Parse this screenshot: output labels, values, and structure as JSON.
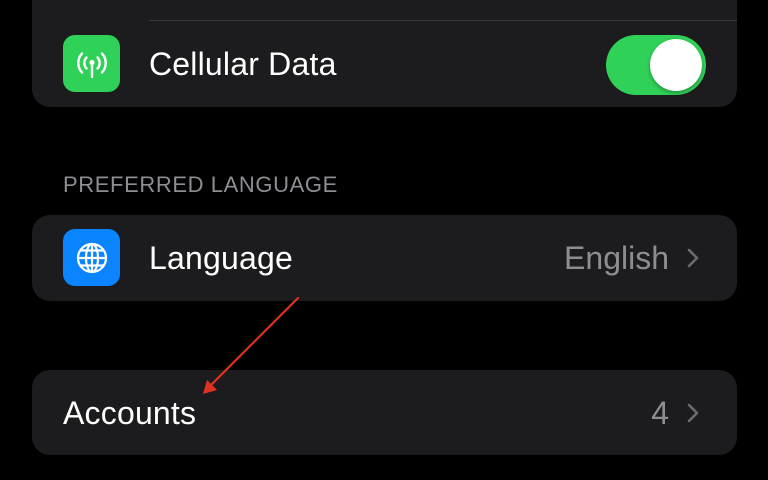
{
  "colors": {
    "background": "#000000",
    "group_bg": "#1c1c1e",
    "cellular_icon_bg": "#30d158",
    "language_icon_bg": "#0a84ff",
    "toggle_on": "#30d158",
    "secondary_text": "#8d8d93",
    "annotation_arrow": "#e0311f"
  },
  "cellular": {
    "icon": "antenna-signal-icon",
    "label": "Cellular Data",
    "toggle_state": "on"
  },
  "preferred_language": {
    "header": "PREFERRED LANGUAGE",
    "row": {
      "icon": "globe-icon",
      "label": "Language",
      "value": "English"
    }
  },
  "accounts": {
    "label": "Accounts",
    "value": "4"
  }
}
